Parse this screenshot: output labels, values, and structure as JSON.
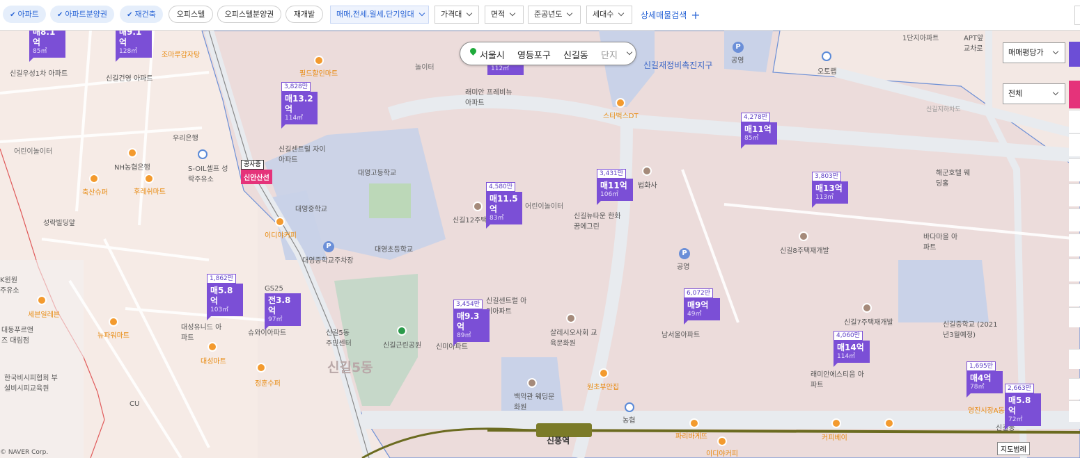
{
  "filters": {
    "property_types": [
      {
        "label": "아파트",
        "checked": true
      },
      {
        "label": "아파트분양권",
        "checked": true
      },
      {
        "label": "재건축",
        "checked": true
      },
      {
        "label": "오피스텔",
        "checked": false
      },
      {
        "label": "오피스텔분양권",
        "checked": false
      },
      {
        "label": "재개발",
        "checked": false
      }
    ],
    "dropdowns": [
      "매매,전세,월세,단기임대",
      "가격대",
      "면적",
      "준공년도",
      "세대수"
    ],
    "detail_search": "상세매물검색",
    "check_mark": "✔",
    "plus": "+"
  },
  "search_bar": {
    "city": "서울시",
    "district": "영등포구",
    "dong": "신길동",
    "type": "단지"
  },
  "right_panel": {
    "price_select": "매매평당가",
    "all_select": "전체"
  },
  "legend_button": "지도범례",
  "copyright": "© NAVER Corp.",
  "zone_label": "신길재정비촉진지구",
  "dong_label": "신길5동",
  "station": "신풍역",
  "construction": {
    "tag": "공사중",
    "name": "신안산선"
  },
  "markers": [
    {
      "top": "",
      "price": "매8.1억",
      "area": "85㎡"
    },
    {
      "top": "",
      "price": "매9.1억",
      "area": "128㎡"
    },
    {
      "top": "3,828만",
      "price": "매13.2억",
      "area": "114㎡"
    },
    {
      "top": "",
      "price": "",
      "area": "112㎡"
    },
    {
      "top": "4,580만",
      "price": "매11.5억",
      "area": "83㎡"
    },
    {
      "top": "3,431만",
      "price": "매11억",
      "area": "106㎡"
    },
    {
      "top": "4,278만",
      "price": "매11억",
      "area": "85㎡"
    },
    {
      "top": "3,803만",
      "price": "매13억",
      "area": "113㎡"
    },
    {
      "top": "1,862만",
      "price": "매5.8억",
      "area": "103㎡"
    },
    {
      "top": "",
      "price": "전3.8억",
      "area": "97㎡"
    },
    {
      "top": "3,454만",
      "price": "매9.3억",
      "area": "89㎡"
    },
    {
      "top": "6,072만",
      "price": "매9억",
      "area": "49㎡"
    },
    {
      "top": "4,060만",
      "price": "매14억",
      "area": "114㎡"
    },
    {
      "top": "1,695만",
      "price": "매4억",
      "area": "78㎡"
    },
    {
      "top": "2,663만",
      "price": "매5.8억",
      "area": "72㎡"
    }
  ],
  "labels": [
    "신길우성1차 아파트",
    "신길건영 아파트",
    "조마루감자탕",
    "필드할인마트",
    "우리은행",
    "NH농협은행",
    "S-OIL셀프 성락주유소",
    "어린이놀이터",
    "축산슈퍼",
    "후레쉬마트",
    "성락빌딩앞",
    "신길센트럴 자이아파트",
    "대영고등학교",
    "대영중학교",
    "이디야커피",
    "대영초등학교",
    "대영중학교주차장",
    "래미안 프레비뉴아파트",
    "놀이터",
    "신길12주택재개발",
    "어린이놀이터",
    "신길뉴타운 한화꿈에그린",
    "법화사",
    "스타벅스DT",
    "공영",
    "오토랩",
    "1단지아파트",
    "APT앞 교차로",
    "신길지하차도",
    "해군호텔 웨딩홀",
    "신길8주택재개발",
    "바다마을 아파트",
    "신길7주택재개발",
    "신길중학교 (2021년3월예정)",
    "래미안에스티움 아파트",
    "영진시장A동",
    "신길동",
    "대성유니드 아파트",
    "GS25",
    "슈와이아파트",
    "세븐일레븐",
    "뉴파워마트",
    "대동푸르앤즈 대림점",
    "한국비시피협회 부설비시피교육원",
    "대성마트",
    "정훈수퍼",
    "CU",
    "신길센트럴 아이아파트",
    "신미아파트",
    "신길5동 주민센터",
    "신길근린공원",
    "살레시오사회 교육문화원",
    "백악관 웨딩문화원",
    "원초부안집",
    "농협",
    "파리바게뜨",
    "커피베이",
    "이디야커피",
    "남서울아파트",
    "공영",
    "K윈원 주유소"
  ]
}
